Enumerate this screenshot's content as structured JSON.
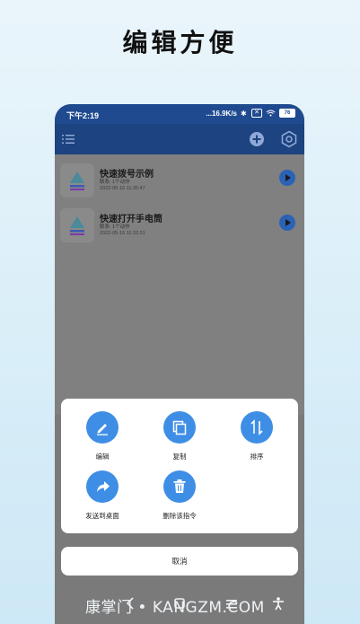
{
  "headline": "编辑方便",
  "status_bar": {
    "time": "下午2:19",
    "network_speed": "...16.9K/s",
    "battery": "76"
  },
  "list": {
    "items": [
      {
        "title": "快速拨号示例",
        "subtitle": "联系: 1个动作",
        "date": "2022-05-16 11:36:47"
      },
      {
        "title": "快速打开手电筒",
        "subtitle": "联系: 1个动作",
        "date": "2022-05-16 11:32:31"
      }
    ]
  },
  "actions": {
    "edit": "编辑",
    "copy": "复制",
    "sort": "排序",
    "send_to_desktop": "发送到桌面",
    "delete": "删除该指令"
  },
  "cancel_label": "取消",
  "watermark": "康掌门 • KANGZM.COM",
  "colors": {
    "status_bar": "#1f4a8f",
    "toolbar": "#1d4380",
    "accent": "#3f8ee6",
    "overlay": "#7a7a7a"
  },
  "icons": [
    "menu-icon",
    "add-icon",
    "settings-hex-icon",
    "app-logo-icon",
    "play-icon",
    "edit-icon",
    "copy-icon",
    "sort-icon",
    "share-icon",
    "trash-icon",
    "back-icon",
    "home-icon",
    "recents-icon",
    "accessibility-icon"
  ]
}
